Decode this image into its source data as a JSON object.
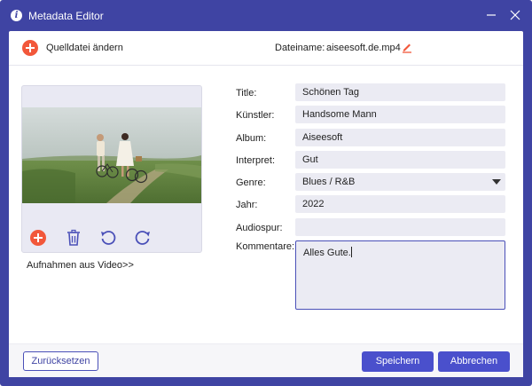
{
  "window": {
    "title": "Metadata Editor",
    "title_icon": "info-icon",
    "controls": [
      "minimize-icon",
      "close-icon"
    ]
  },
  "topbar": {
    "change_source_label": "Quelldatei ändern",
    "filename_label": "Dateiname:",
    "filename_value": "aiseesoft.de.mp4",
    "edit_icon": "pencil-icon"
  },
  "preview": {
    "controls": [
      "add-icon",
      "trash-icon",
      "rotate-left-icon",
      "rotate-right-icon"
    ],
    "capture_label": "Aufnahmen aus Video>>"
  },
  "form": {
    "fields": [
      {
        "label": "Title:",
        "value": "Schönen Tag"
      },
      {
        "label": "Künstler:",
        "value": "Handsome Mann"
      },
      {
        "label": "Album:",
        "value": "Aiseesoft"
      },
      {
        "label": "Interpret:",
        "value": "Gut"
      },
      {
        "label": "Genre:",
        "value": "Blues / R&B"
      },
      {
        "label": "Jahr:",
        "value": "2022"
      },
      {
        "label": "Audiospur:",
        "value": ""
      }
    ],
    "comment_label": "Kommentare:",
    "comment_value": "Alles Gute."
  },
  "footer": {
    "reset_label": "Zurücksetzen",
    "save_label": "Speichern",
    "cancel_label": "Abbrechen"
  },
  "colors": {
    "frame": "#3f44a3",
    "accent_button": "#4a50cc",
    "add_icon": "#f2573a",
    "field_bg": "#ebebf3"
  }
}
